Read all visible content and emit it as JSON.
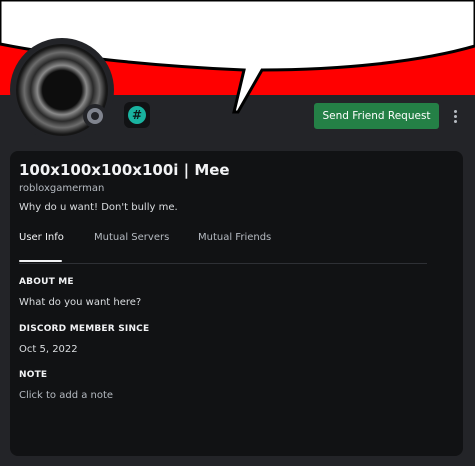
{
  "banner": {
    "color": "#ff0000",
    "speech_bubble_color": "#ffffff"
  },
  "avatar": {
    "status": "offline",
    "status_color": "#80848e"
  },
  "badge": {
    "glyph": "#",
    "color": "#19b3a0"
  },
  "actions": {
    "send_friend_request": "Send Friend Request",
    "button_color": "#248046",
    "more_icon": "more-vertical-icon"
  },
  "profile": {
    "display_name": "100x100x100x100i | Mee",
    "username": "robloxgamerman",
    "custom_status": "Why do u want! Don't bully me."
  },
  "tabs": [
    {
      "label": "User Info",
      "active": true
    },
    {
      "label": "Mutual Servers",
      "active": false
    },
    {
      "label": "Mutual Friends",
      "active": false
    }
  ],
  "sections": {
    "about_me": {
      "heading": "ABOUT ME",
      "text": "What do you want here?"
    },
    "member_since": {
      "heading": "DISCORD MEMBER SINCE",
      "text": "Oct 5, 2022"
    },
    "note": {
      "heading": "NOTE",
      "placeholder": "Click to add a note"
    }
  }
}
